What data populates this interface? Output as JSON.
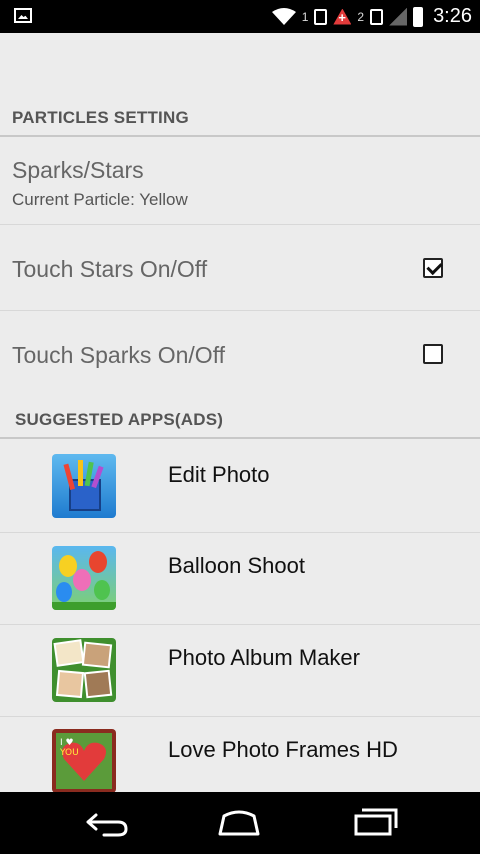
{
  "statusbar": {
    "sim1": "1",
    "sim2": "2",
    "time": "3:26"
  },
  "particles": {
    "header": "PARTICLES SETTING",
    "sparks_title": "Sparks/Stars",
    "current_particle": "Current Particle:  Yellow",
    "touch_stars_label": "Touch Stars On/Off",
    "touch_stars_checked": true,
    "touch_sparks_label": "Touch Sparks On/Off",
    "touch_sparks_checked": false
  },
  "suggested": {
    "header": "SUGGESTED APPS(ADS)",
    "apps": [
      {
        "name": "Edit Photo",
        "icon": "paint-brushes-cup-icon"
      },
      {
        "name": "Balloon Shoot",
        "icon": "balloons-icon"
      },
      {
        "name": "Photo Album Maker",
        "icon": "photo-collage-icon"
      },
      {
        "name": "Love Photo Frames HD",
        "icon": "love-frame-icon"
      }
    ]
  },
  "nav": {
    "back_icon": "back-icon",
    "home_icon": "home-icon",
    "recent_icon": "recent-apps-icon"
  },
  "colors": {
    "background": "#ececec",
    "statusbar": "#000000",
    "header_text": "#555555",
    "item_text": "#666666"
  }
}
